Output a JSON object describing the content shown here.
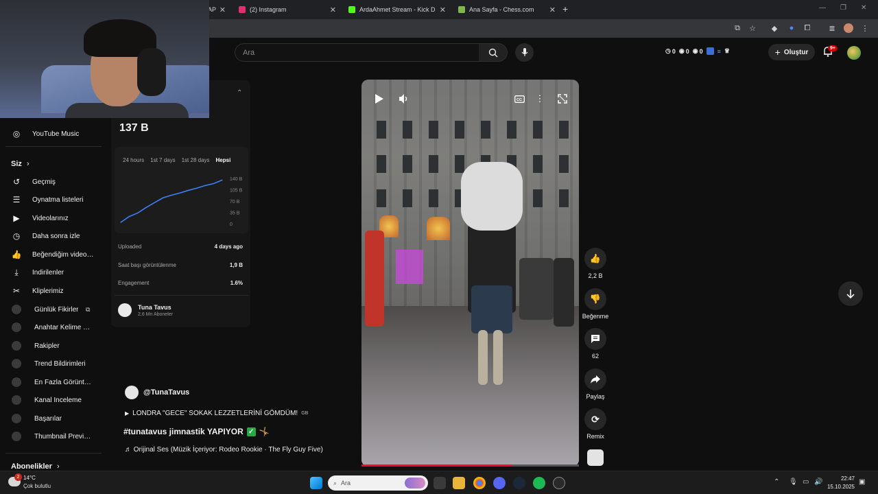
{
  "browser": {
    "tabs": [
      {
        "title": "AP",
        "favicon_color": "#c0392b"
      },
      {
        "title": "(2) Instagram",
        "favicon_color": "#e1306c"
      },
      {
        "title": "ArdaAhmet Stream - Kick Dashb",
        "favicon_color": "#53fc18"
      },
      {
        "title": "Ana Sayfa - Chess.com",
        "favicon_color": "#81b64c"
      }
    ],
    "new_tab_label": "+"
  },
  "header": {
    "search_placeholder": "Ara",
    "counters": [
      "0",
      "0",
      "0"
    ],
    "create_label": "Oluştur",
    "notifications_badge": "9+"
  },
  "sidebar": {
    "items_top": [
      {
        "label": "YouTube Music",
        "icon": "youtube-music-icon"
      }
    ],
    "you_section": {
      "heading": "Siz"
    },
    "you_items": [
      {
        "label": "Geçmiş",
        "icon": "history-icon"
      },
      {
        "label": "Oynatma listeleri",
        "icon": "playlist-icon"
      },
      {
        "label": "Videolarınız",
        "icon": "your-videos-icon"
      },
      {
        "label": "Daha sonra izle",
        "icon": "watch-later-icon"
      },
      {
        "label": "Beğendiğim videolar",
        "icon": "liked-icon"
      },
      {
        "label": "İndirilenler",
        "icon": "download-icon"
      },
      {
        "label": "Kliplerimiz",
        "icon": "clips-icon"
      }
    ],
    "extension_items": [
      {
        "label": "Günlük Fikirler"
      },
      {
        "label": "Anahtar Kelime Ko..."
      },
      {
        "label": "Rakipler"
      },
      {
        "label": "Trend Bildirimleri"
      },
      {
        "label": "En Fazla Görüntüle..."
      },
      {
        "label": "Kanal İnceleme"
      },
      {
        "label": "Başarılar"
      },
      {
        "label": "Thumbnail Preview"
      }
    ],
    "subscriptions_heading": "Abonelikler"
  },
  "analytics": {
    "views": "137 B",
    "range_tabs": [
      "24 hours",
      "1st 7 days",
      "1st 28 days",
      "Hepsi"
    ],
    "active_range": "Hepsi",
    "stats": [
      {
        "label": "Uploaded",
        "value": "4 days ago"
      },
      {
        "label": "Saat başı görüntülenme",
        "value": "1,9 B"
      },
      {
        "label": "Engagement",
        "value": "1.6%"
      }
    ],
    "channel": {
      "name": "Tuna Tavus",
      "subscribers": "2,6 Mn Aboneler"
    }
  },
  "chart_data": {
    "type": "line",
    "x": [
      0,
      1,
      2,
      3,
      4,
      5,
      6,
      7,
      8,
      9,
      10,
      11,
      12
    ],
    "values": [
      4,
      22,
      33,
      50,
      65,
      80,
      88,
      95,
      103,
      110,
      118,
      124,
      135
    ],
    "ytick_labels": [
      "140 B",
      "105 B",
      "70 B",
      "35 B",
      "0"
    ],
    "ylim": [
      0,
      140
    ],
    "color": "#3b82f6"
  },
  "short": {
    "handle": "@TunaTavus",
    "title": "LONDRA \"GECE\" SOKAK LEZZETLERİNİ GÖMDÜM!",
    "title_tag": "GB",
    "description": "#tunatavus jimnastik YAPIYOR",
    "audio": "Orijinal Ses (Müzik İçeriyor: Rodeo Rookie · The Fly Guy Five)",
    "progress": 0.69
  },
  "actions": [
    {
      "label": "2,2 B",
      "icon": "like-icon"
    },
    {
      "label": "Beğenme",
      "icon": "dislike-icon"
    },
    {
      "label": "62",
      "icon": "comment-icon"
    },
    {
      "label": "Paylaş",
      "icon": "share-icon"
    },
    {
      "label": "Remix",
      "icon": "remix-icon"
    }
  ],
  "taskbar": {
    "weather_badge": "2",
    "temperature": "14°C",
    "weather_desc": "Çok bulutlu",
    "search_placeholder": "Ara",
    "time": "22:47",
    "date": "15.10.2025"
  }
}
